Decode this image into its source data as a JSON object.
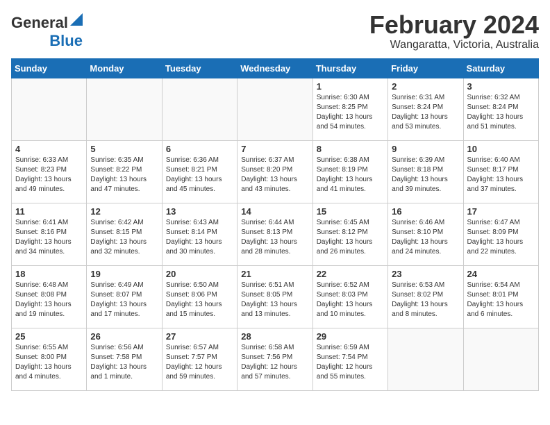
{
  "header": {
    "logo_line1": "General",
    "logo_line2": "Blue",
    "month": "February 2024",
    "location": "Wangaratta, Victoria, Australia"
  },
  "days_of_week": [
    "Sunday",
    "Monday",
    "Tuesday",
    "Wednesday",
    "Thursday",
    "Friday",
    "Saturday"
  ],
  "weeks": [
    [
      {
        "day": "",
        "info": ""
      },
      {
        "day": "",
        "info": ""
      },
      {
        "day": "",
        "info": ""
      },
      {
        "day": "",
        "info": ""
      },
      {
        "day": "1",
        "info": "Sunrise: 6:30 AM\nSunset: 8:25 PM\nDaylight: 13 hours\nand 54 minutes."
      },
      {
        "day": "2",
        "info": "Sunrise: 6:31 AM\nSunset: 8:24 PM\nDaylight: 13 hours\nand 53 minutes."
      },
      {
        "day": "3",
        "info": "Sunrise: 6:32 AM\nSunset: 8:24 PM\nDaylight: 13 hours\nand 51 minutes."
      }
    ],
    [
      {
        "day": "4",
        "info": "Sunrise: 6:33 AM\nSunset: 8:23 PM\nDaylight: 13 hours\nand 49 minutes."
      },
      {
        "day": "5",
        "info": "Sunrise: 6:35 AM\nSunset: 8:22 PM\nDaylight: 13 hours\nand 47 minutes."
      },
      {
        "day": "6",
        "info": "Sunrise: 6:36 AM\nSunset: 8:21 PM\nDaylight: 13 hours\nand 45 minutes."
      },
      {
        "day": "7",
        "info": "Sunrise: 6:37 AM\nSunset: 8:20 PM\nDaylight: 13 hours\nand 43 minutes."
      },
      {
        "day": "8",
        "info": "Sunrise: 6:38 AM\nSunset: 8:19 PM\nDaylight: 13 hours\nand 41 minutes."
      },
      {
        "day": "9",
        "info": "Sunrise: 6:39 AM\nSunset: 8:18 PM\nDaylight: 13 hours\nand 39 minutes."
      },
      {
        "day": "10",
        "info": "Sunrise: 6:40 AM\nSunset: 8:17 PM\nDaylight: 13 hours\nand 37 minutes."
      }
    ],
    [
      {
        "day": "11",
        "info": "Sunrise: 6:41 AM\nSunset: 8:16 PM\nDaylight: 13 hours\nand 34 minutes."
      },
      {
        "day": "12",
        "info": "Sunrise: 6:42 AM\nSunset: 8:15 PM\nDaylight: 13 hours\nand 32 minutes."
      },
      {
        "day": "13",
        "info": "Sunrise: 6:43 AM\nSunset: 8:14 PM\nDaylight: 13 hours\nand 30 minutes."
      },
      {
        "day": "14",
        "info": "Sunrise: 6:44 AM\nSunset: 8:13 PM\nDaylight: 13 hours\nand 28 minutes."
      },
      {
        "day": "15",
        "info": "Sunrise: 6:45 AM\nSunset: 8:12 PM\nDaylight: 13 hours\nand 26 minutes."
      },
      {
        "day": "16",
        "info": "Sunrise: 6:46 AM\nSunset: 8:10 PM\nDaylight: 13 hours\nand 24 minutes."
      },
      {
        "day": "17",
        "info": "Sunrise: 6:47 AM\nSunset: 8:09 PM\nDaylight: 13 hours\nand 22 minutes."
      }
    ],
    [
      {
        "day": "18",
        "info": "Sunrise: 6:48 AM\nSunset: 8:08 PM\nDaylight: 13 hours\nand 19 minutes."
      },
      {
        "day": "19",
        "info": "Sunrise: 6:49 AM\nSunset: 8:07 PM\nDaylight: 13 hours\nand 17 minutes."
      },
      {
        "day": "20",
        "info": "Sunrise: 6:50 AM\nSunset: 8:06 PM\nDaylight: 13 hours\nand 15 minutes."
      },
      {
        "day": "21",
        "info": "Sunrise: 6:51 AM\nSunset: 8:05 PM\nDaylight: 13 hours\nand 13 minutes."
      },
      {
        "day": "22",
        "info": "Sunrise: 6:52 AM\nSunset: 8:03 PM\nDaylight: 13 hours\nand 10 minutes."
      },
      {
        "day": "23",
        "info": "Sunrise: 6:53 AM\nSunset: 8:02 PM\nDaylight: 13 hours\nand 8 minutes."
      },
      {
        "day": "24",
        "info": "Sunrise: 6:54 AM\nSunset: 8:01 PM\nDaylight: 13 hours\nand 6 minutes."
      }
    ],
    [
      {
        "day": "25",
        "info": "Sunrise: 6:55 AM\nSunset: 8:00 PM\nDaylight: 13 hours\nand 4 minutes."
      },
      {
        "day": "26",
        "info": "Sunrise: 6:56 AM\nSunset: 7:58 PM\nDaylight: 13 hours\nand 1 minute."
      },
      {
        "day": "27",
        "info": "Sunrise: 6:57 AM\nSunset: 7:57 PM\nDaylight: 12 hours\nand 59 minutes."
      },
      {
        "day": "28",
        "info": "Sunrise: 6:58 AM\nSunset: 7:56 PM\nDaylight: 12 hours\nand 57 minutes."
      },
      {
        "day": "29",
        "info": "Sunrise: 6:59 AM\nSunset: 7:54 PM\nDaylight: 12 hours\nand 55 minutes."
      },
      {
        "day": "",
        "info": ""
      },
      {
        "day": "",
        "info": ""
      }
    ]
  ]
}
